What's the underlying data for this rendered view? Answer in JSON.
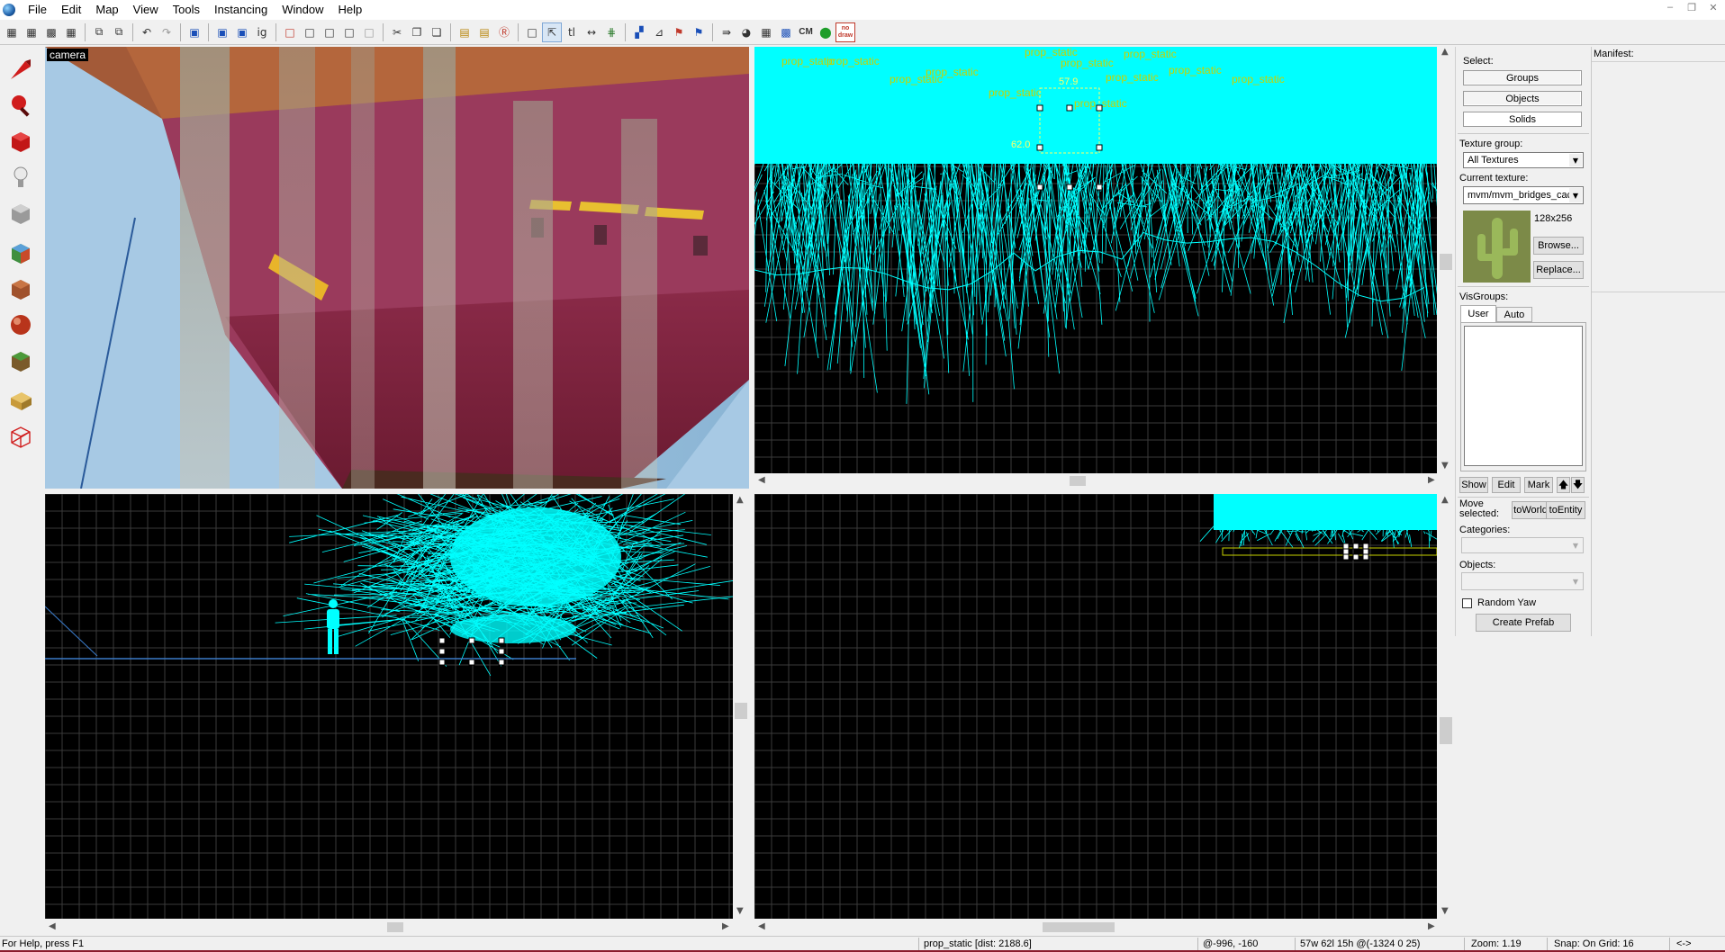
{
  "menu": [
    "File",
    "Edit",
    "Map",
    "View",
    "Tools",
    "Instancing",
    "Window",
    "Help"
  ],
  "toolbar": {
    "cm_label": "CM",
    "nodraw_label": "no draw"
  },
  "viewports": {
    "camera_label": "camera"
  },
  "top_right_view": {
    "entity_labels": [
      "prop_static",
      "prop_static",
      "prop_static",
      "prop_static",
      "prop_static",
      "prop_static",
      "prop_static",
      "prop_static",
      "prop_static",
      "prop_static",
      "prop_static",
      "prop_static"
    ],
    "dim_top": "57.9",
    "dim_side": "62.0"
  },
  "right_panel": {
    "select_label": "Select:",
    "groups_btn": "Groups",
    "objects_btn": "Objects",
    "solids_btn": "Solids",
    "texture_group_label": "Texture group:",
    "texture_group_value": "All Textures",
    "current_texture_label": "Current texture:",
    "current_texture_value": "mvm/mvm_bridges_cac",
    "texture_size": "128x256",
    "browse_btn": "Browse...",
    "replace_btn": "Replace...",
    "visgroups_label": "VisGroups:",
    "tab_user": "User",
    "tab_auto": "Auto",
    "show_btn": "Show",
    "edit_btn": "Edit",
    "mark_btn": "Mark",
    "move_selected_label": "Move selected:",
    "toworld_btn": "toWorld",
    "toentity_btn": "toEntity",
    "categories_label": "Categories:",
    "objects_label": "Objects:",
    "random_yaw_label": "Random Yaw",
    "random_yaw_checked": false,
    "create_prefab_btn": "Create Prefab"
  },
  "manifest": {
    "label": "Manifest:"
  },
  "status": {
    "help": "For Help, press F1",
    "selection": "prop_static  [dist: 2188.6]",
    "coords": "@-996, -160",
    "size": "57w 62l 15h @(-1324 0 25)",
    "zoom": "Zoom: 1.19",
    "snap": "Snap: On Grid: 16",
    "arrows": "<->"
  },
  "colors": {
    "wire": "#00ffff",
    "grid": "#3a3a3a",
    "entity_text": "#c8d200",
    "accent": "#8b1a2b"
  }
}
